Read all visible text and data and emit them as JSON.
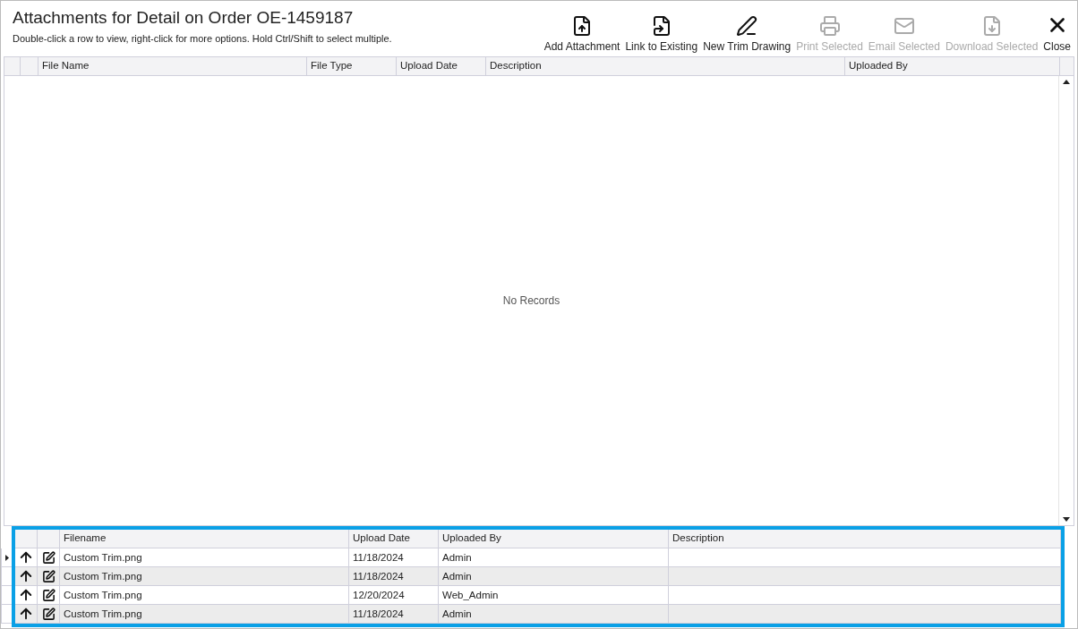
{
  "window": {
    "title": "Attachments for Detail on Order OE-1459187",
    "hint": "Double-click a row to view, right-click for more options. Hold Ctrl/Shift to select multiple."
  },
  "toolbar": [
    {
      "kind": "add",
      "label": "Add Attachment",
      "disabled": false
    },
    {
      "kind": "link",
      "label": "Link to Existing",
      "disabled": false
    },
    {
      "kind": "draw",
      "label": "New Trim Drawing",
      "disabled": false
    },
    {
      "kind": "print",
      "label": "Print Selected",
      "disabled": true
    },
    {
      "kind": "email",
      "label": "Email Selected",
      "disabled": true
    },
    {
      "kind": "download",
      "label": "Download Selected",
      "disabled": true
    },
    {
      "kind": "close",
      "label": "Close",
      "disabled": false
    }
  ],
  "attachments_table": {
    "columns": [
      "File Name",
      "File Type",
      "Upload Date",
      "Description",
      "Uploaded By"
    ],
    "empty_message": "No Records"
  },
  "drawings_table": {
    "columns": [
      "Filename",
      "Upload Date",
      "Uploaded By",
      "Description"
    ],
    "rows": [
      {
        "filename": "Custom Trim.png",
        "upload_date": "11/18/2024",
        "uploaded_by": "Admin",
        "current": true
      },
      {
        "filename": "Custom Trim.png",
        "upload_date": "11/18/2024",
        "uploaded_by": "Admin",
        "current": false
      },
      {
        "filename": "Custom Trim.png",
        "upload_date": "12/20/2024",
        "uploaded_by": "Web_Admin",
        "current": false
      },
      {
        "filename": "Custom Trim.png",
        "upload_date": "11/18/2024",
        "uploaded_by": "Admin",
        "current": false
      }
    ]
  }
}
